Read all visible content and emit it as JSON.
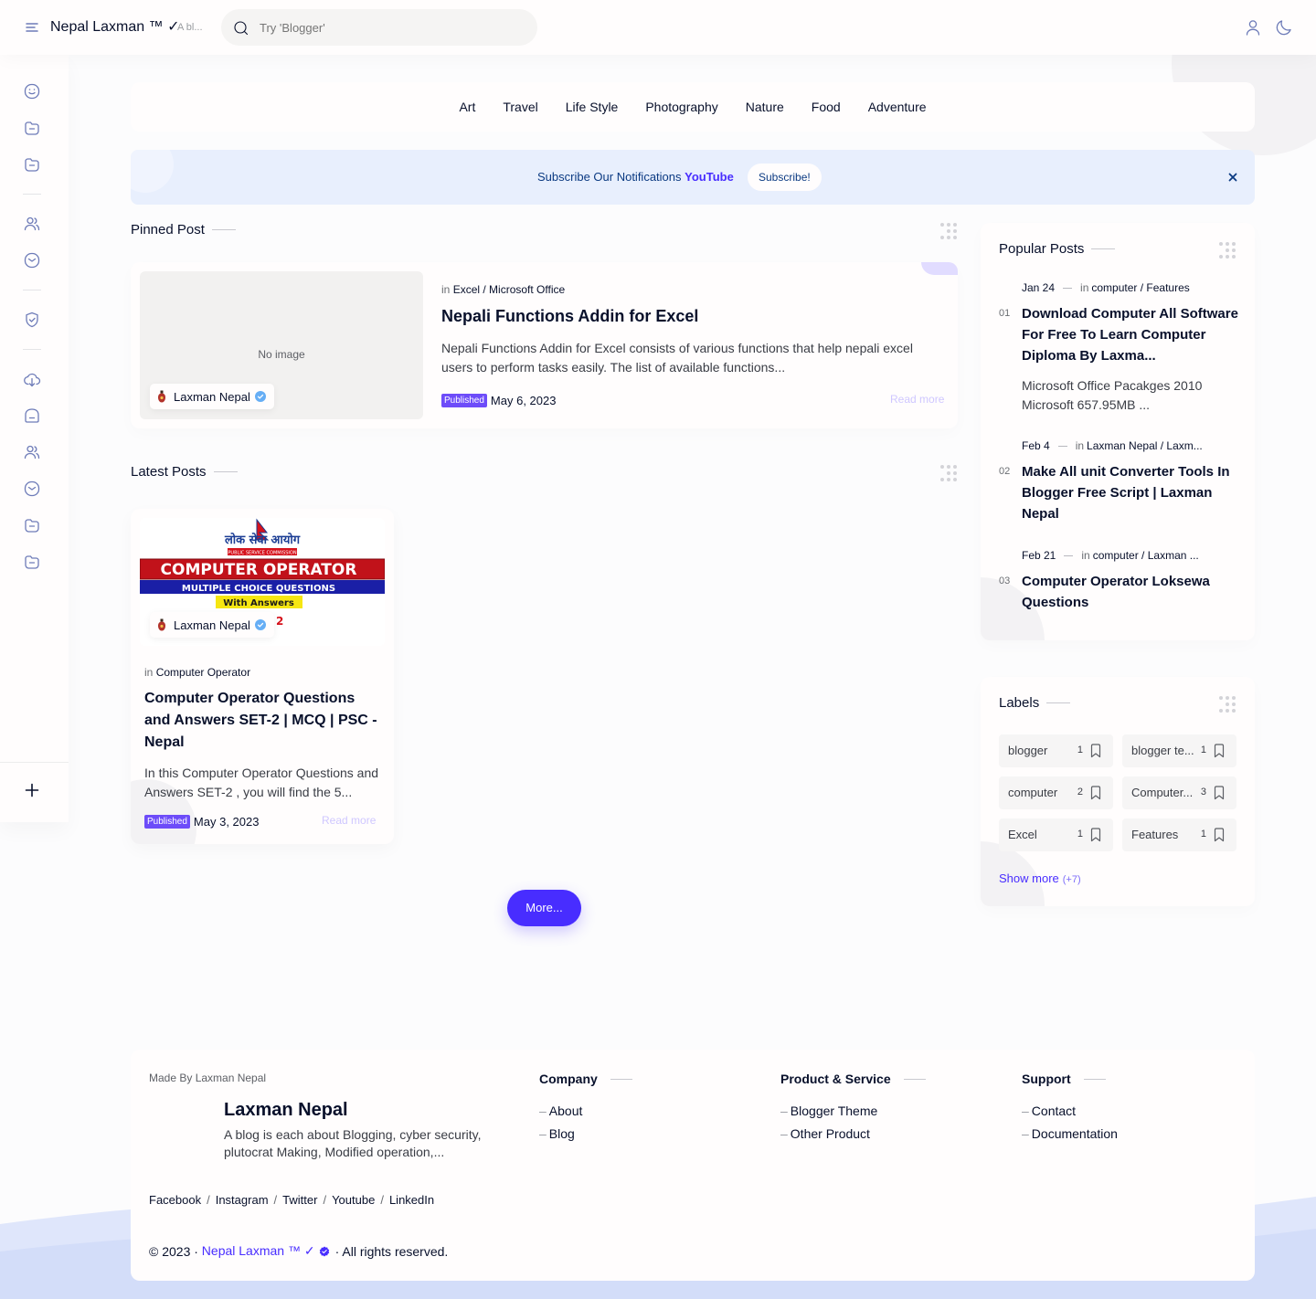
{
  "header": {
    "brand": "Nepal Laxman ™ ✓",
    "brand_desc": "A bl...",
    "search_placeholder": "Try 'Blogger'"
  },
  "sidebar": {
    "icons": [
      "smile-icon",
      "folder-icon",
      "folder-icon",
      "users-icon",
      "smile-icon",
      "shield-icon",
      "download-icon",
      "home-icon",
      "users-icon",
      "smile-icon",
      "folder-icon",
      "folder-icon",
      "plus-icon"
    ]
  },
  "categories": [
    "Art",
    "Travel",
    "Life Style",
    "Photography",
    "Nature",
    "Food",
    "Adventure"
  ],
  "notification": {
    "text": "Subscribe Our Notifications",
    "highlight": "YouTube",
    "button": "Subscribe!"
  },
  "pinned": {
    "section_title": "Pinned Post",
    "no_image": "No image",
    "author": "Laxman Nepal",
    "in": "in",
    "labels": "Excel / Microsoft Office",
    "title": "Nepali Functions Addin for Excel",
    "snippet": "Nepali Functions Addin for Excel consists  of various functions that help nepali excel users to perform tasks easily. The list of available functions...",
    "badge": "Published",
    "date": "May 6, 2023",
    "read_more": "Read more"
  },
  "latest": {
    "section_title": "Latest Posts",
    "thumb": {
      "line1": "लोक सेवा आयोग",
      "line2": "PUBLIC SERVICE COMMISSION",
      "line3": "COMPUTER OPERATOR",
      "line4": "MULTIPLE CHOICE QUESTIONS",
      "line5": "With Answers",
      "set": "2"
    },
    "author": "Laxman Nepal",
    "in": "in",
    "labels": "Computer Operator",
    "title": "Computer Operator Questions and Answers SET-2 | MCQ | PSC - Nepal",
    "snippet": "In this  Computer Operator Questions and Answers SET-2 , you will find the 5...",
    "badge": "Published",
    "date": "May 3, 2023",
    "read_more": "Read more",
    "more_button": "More..."
  },
  "popular": {
    "title": "Popular Posts",
    "posts": [
      {
        "date": "Jan 24",
        "in": "in",
        "labels": "computer / Features",
        "num": "01",
        "title": "Download Computer All Software For Free To Learn Computer Diploma By Laxma...",
        "snippet": "Microsoft Office Pacakges 2010 Microsoft 657.95MB ..."
      },
      {
        "date": "Feb 4",
        "in": "in",
        "labels": "Laxman Nepal / Laxm...",
        "num": "02",
        "title": "Make All unit Converter Tools In Blogger Free Script | Laxman Nepal",
        "snippet": ""
      },
      {
        "date": "Feb 21",
        "in": "in",
        "labels": "computer / Laxman ...",
        "num": "03",
        "title": "Computer Operator Loksewa Questions",
        "snippet": ""
      }
    ]
  },
  "labels_widget": {
    "title": "Labels",
    "items": [
      {
        "name": "blogger",
        "count": "1"
      },
      {
        "name": "blogger te...",
        "count": "1"
      },
      {
        "name": "computer",
        "count": "2"
      },
      {
        "name": "Computer...",
        "count": "3"
      },
      {
        "name": "Excel",
        "count": "1"
      },
      {
        "name": "Features",
        "count": "1"
      }
    ],
    "show_more": "Show more",
    "show_more_count": "(+7)"
  },
  "footer": {
    "made_by": "Made By Laxman Nepal",
    "name": "Laxman Nepal",
    "desc": "A blog is each about Blogging, cyber security, plutocrat Making, Modified operation,...",
    "columns": [
      {
        "title": "Company",
        "links": [
          "About",
          "Blog"
        ]
      },
      {
        "title": "Product & Service",
        "links": [
          "Blogger Theme",
          "Other Product"
        ]
      },
      {
        "title": "Support",
        "links": [
          "Contact",
          "Documentation"
        ]
      }
    ],
    "social": [
      "Facebook",
      "Instagram",
      "Twitter",
      "Youtube",
      "LinkedIn"
    ],
    "social_sep": "/",
    "copy_prefix": "© 2023 · ",
    "copy_site": "Nepal Laxman ™ ✓",
    "copy_suffix": "· All rights reserved."
  },
  "colors": {
    "accent": "#482dff",
    "badge": "#6d4cf9",
    "notif_bg": "#e8effd",
    "text": "#08102b"
  }
}
